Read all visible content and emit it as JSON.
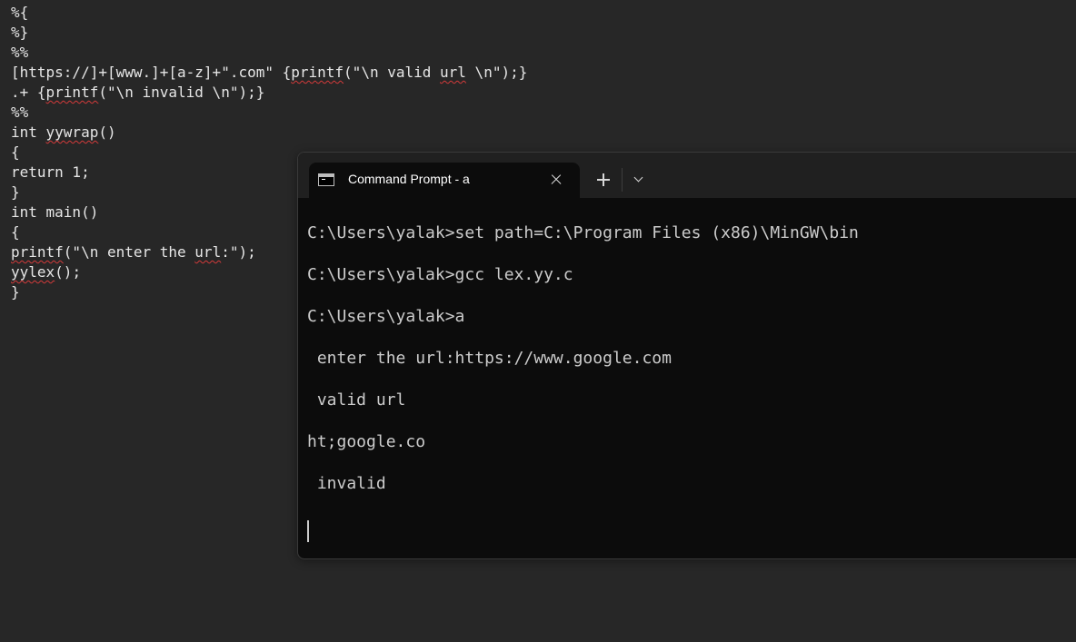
{
  "editor": {
    "lines": [
      {
        "parts": [
          {
            "t": "%{"
          }
        ]
      },
      {
        "parts": [
          {
            "t": "%}"
          }
        ]
      },
      {
        "parts": [
          {
            "t": "%%"
          }
        ]
      },
      {
        "parts": [
          {
            "t": "[https://]+[www.]+[a-z]+\".com\" {"
          },
          {
            "t": "printf",
            "s": true
          },
          {
            "t": "(\"\\n valid "
          },
          {
            "t": "url",
            "s": true
          },
          {
            "t": " \\n\");}"
          }
        ]
      },
      {
        "parts": [
          {
            "t": ".+ {"
          },
          {
            "t": "printf",
            "s": true
          },
          {
            "t": "(\"\\n invalid \\n\");}"
          }
        ]
      },
      {
        "parts": [
          {
            "t": "%%"
          }
        ]
      },
      {
        "parts": [
          {
            "t": "int "
          },
          {
            "t": "yywrap",
            "s": true
          },
          {
            "t": "()"
          }
        ]
      },
      {
        "parts": [
          {
            "t": "{"
          }
        ]
      },
      {
        "parts": [
          {
            "t": "return 1;"
          }
        ]
      },
      {
        "parts": [
          {
            "t": "}"
          }
        ]
      },
      {
        "parts": [
          {
            "t": "int main()"
          }
        ]
      },
      {
        "parts": [
          {
            "t": "{"
          }
        ]
      },
      {
        "parts": [
          {
            "t": "printf",
            "s": true
          },
          {
            "t": "(\"\\n enter the "
          },
          {
            "t": "url",
            "s": true
          },
          {
            "t": ":\");"
          }
        ]
      },
      {
        "parts": [
          {
            "t": "yylex",
            "s": true
          },
          {
            "t": "();"
          }
        ]
      },
      {
        "parts": [
          {
            "t": "}"
          }
        ]
      }
    ]
  },
  "terminal": {
    "tab_title": "Command Prompt - a",
    "tab_icon": "command-prompt-icon",
    "close_icon": "close-icon",
    "new_tab_icon": "plus-icon",
    "dropdown_icon": "chevron-down-icon",
    "lines": [
      "C:\\Users\\yalak>set path=C:\\Program Files (x86)\\MinGW\\bin",
      "",
      "C:\\Users\\yalak>gcc lex.yy.c",
      "",
      "C:\\Users\\yalak>a",
      "",
      " enter the url:https://www.google.com",
      "",
      " valid url",
      "",
      "ht;google.co",
      "",
      " invalid"
    ]
  },
  "colors": {
    "editor_background": "#272727",
    "terminal_background": "#0c0c0c",
    "tabbar_background": "#202020",
    "spellcheck_underline": "#d33a3a"
  }
}
